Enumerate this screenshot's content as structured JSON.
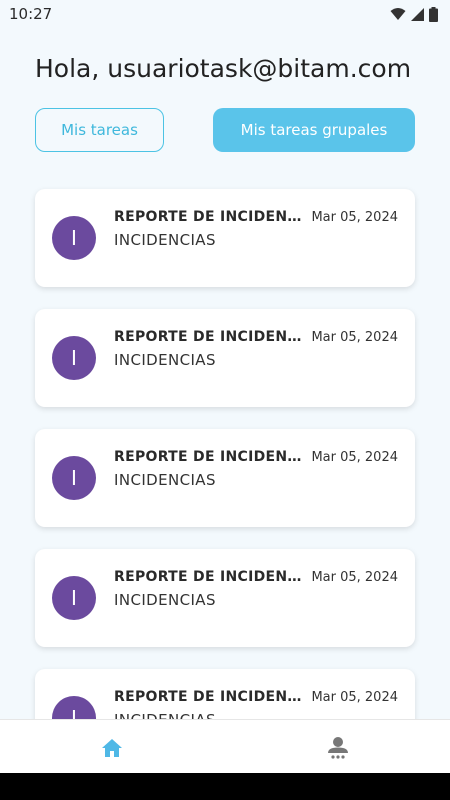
{
  "status_bar": {
    "time": "10:27",
    "icons": [
      "wifi-icon",
      "signal-icon",
      "battery-icon"
    ]
  },
  "header": {
    "greeting": "Hola, usuariotask@bitam.com"
  },
  "tabs": [
    {
      "label": "Mis tareas",
      "active": false
    },
    {
      "label": "Mis tareas grupales",
      "active": true
    }
  ],
  "tasks": [
    {
      "avatar_letter": "I",
      "title": "REPORTE DE INCIDENCIAS",
      "category": "INCIDENCIAS",
      "date": "Mar 05, 2024"
    },
    {
      "avatar_letter": "I",
      "title": "REPORTE DE INCIDENCIAS",
      "category": "INCIDENCIAS",
      "date": "Mar 05, 2024"
    },
    {
      "avatar_letter": "I",
      "title": "REPORTE DE INCIDENCIAS",
      "category": "INCIDENCIAS",
      "date": "Mar 05, 2024"
    },
    {
      "avatar_letter": "I",
      "title": "REPORTE DE INCIDENCIAS",
      "category": "INCIDENCIAS",
      "date": "Mar 05, 2024"
    },
    {
      "avatar_letter": "I",
      "title": "REPORTE DE INCIDENCIAS",
      "category": "INCIDENCIAS",
      "date": "Mar 05, 2024"
    }
  ],
  "bottom_nav": [
    {
      "icon": "home-icon",
      "active": true
    },
    {
      "icon": "profile-icon",
      "active": false
    }
  ],
  "colors": {
    "accent": "#5ac4ea",
    "avatar": "#6b4a9e",
    "background": "#f3f9fd"
  }
}
